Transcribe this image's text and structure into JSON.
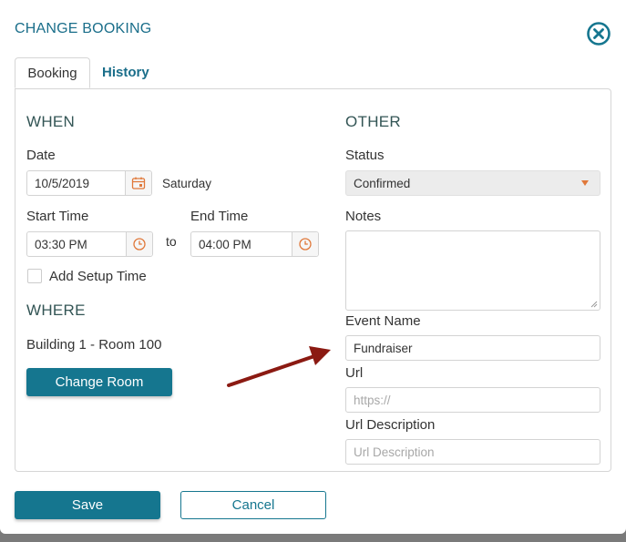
{
  "dialog": {
    "title": "CHANGE BOOKING",
    "close_icon": "close-circle-icon"
  },
  "tabs": [
    {
      "label": "Booking"
    },
    {
      "label": "History"
    }
  ],
  "when": {
    "heading": "WHEN",
    "date_label": "Date",
    "date_value": "10/5/2019",
    "day_of_week": "Saturday",
    "start_label": "Start Time",
    "start_value": "03:30 PM",
    "to_text": "to",
    "end_label": "End Time",
    "end_value": "04:00 PM",
    "setup_label": "Add Setup Time"
  },
  "where": {
    "heading": "WHERE",
    "room": "Building 1 - Room 100",
    "change_room_label": "Change Room"
  },
  "other": {
    "heading": "OTHER",
    "status_label": "Status",
    "status_value": "Confirmed",
    "notes_label": "Notes",
    "event_name_label": "Event Name",
    "event_name_value": "Fundraiser",
    "url_label": "Url",
    "url_placeholder": "https://",
    "url_desc_label": "Url Description",
    "url_desc_placeholder": "Url Description"
  },
  "footer": {
    "save_label": "Save",
    "cancel_label": "Cancel"
  },
  "colors": {
    "primary": "#15768f",
    "accent_icon": "#e0783a",
    "annotation_arrow": "#8b1a12"
  }
}
